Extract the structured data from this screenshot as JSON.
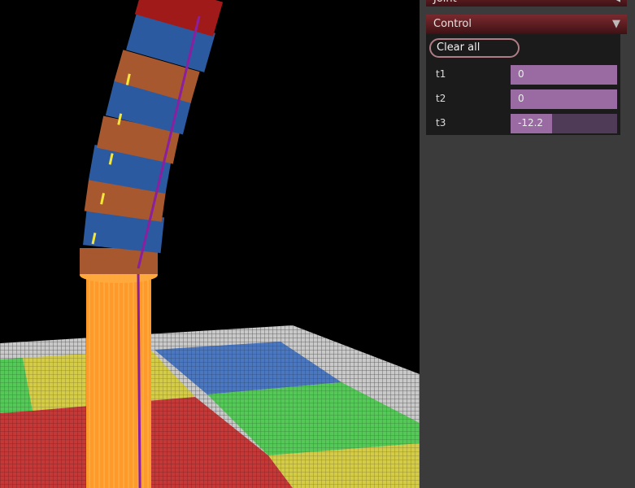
{
  "panel": {
    "previous_folder_label": "Joint",
    "control_folder": {
      "title": "Control",
      "clear_button_label": "Clear all",
      "sliders": [
        {
          "label": "t1",
          "value": "0",
          "fill_fraction": 1.0
        },
        {
          "label": "t2",
          "value": "0",
          "fill_fraction": 1.0
        },
        {
          "label": "t3",
          "value": "-12.2",
          "fill_fraction": 0.39
        }
      ]
    },
    "colors": {
      "header_accent": "#7a2a2e",
      "slider_fill": "#9a6aa3",
      "slider_track": "#4f3b57",
      "panel_bg": "#3b3b3b"
    }
  },
  "scene": {
    "icon": "3d-robot-arm-scene",
    "floor_tile_colors": [
      "#c23a3a",
      "#d8cf4a",
      "#4e7cc4",
      "#4fcf4f",
      "#cfcfcf"
    ],
    "base_color": "#ff9a2a",
    "joint_colors": [
      "#a8582f",
      "#2c5aa0",
      "#a01a1a"
    ]
  }
}
